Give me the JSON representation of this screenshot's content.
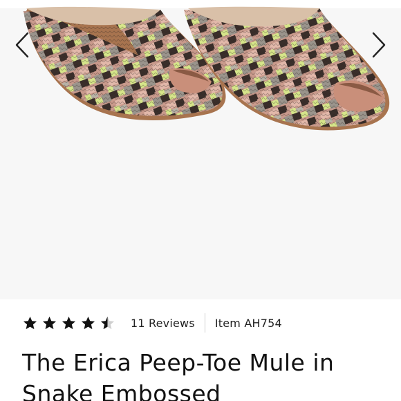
{
  "gallery": {
    "prev_icon": "chevron-left-icon",
    "next_icon": "chevron-right-icon",
    "image_subject": "snake-embossed peep-toe mules",
    "colors": {
      "background": "#f7f7f7",
      "snake_pink": "#c99a8c",
      "snake_lime": "#d6e58a",
      "snake_dark": "#3a2e2a",
      "snake_grey": "#9a948c",
      "leather_tan": "#a8744f"
    }
  },
  "rating": {
    "value": 4.5,
    "max": 5,
    "star_color": "#111111"
  },
  "reviews_label": "11 Reviews",
  "item_number": "Item AH754",
  "product": {
    "title": "The Erica Peep-Toe Mule in Snake Embossed"
  }
}
